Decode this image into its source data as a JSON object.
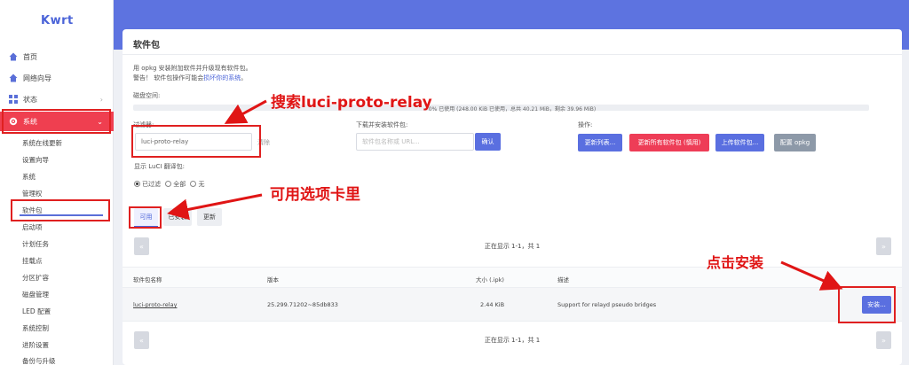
{
  "sidebar": {
    "logo": "Kwrt",
    "nav": [
      {
        "label": "首页",
        "icon": "home-icon"
      },
      {
        "label": "网络向导",
        "icon": "wizard-icon"
      },
      {
        "label": "状态",
        "icon": "status-grid-icon",
        "chevron": "›"
      },
      {
        "label": "系统",
        "icon": "gear-icon",
        "chevron": "⌄",
        "active": true
      }
    ],
    "sub_items": [
      "系统在线更新",
      "设置向导",
      "系统",
      "管理权",
      "软件包",
      "启动项",
      "计划任务",
      "挂载点",
      "分区扩容",
      "磁盘管理",
      "LED 配置",
      "系统控制",
      "进阶设置",
      "备份与升级"
    ],
    "active_sub": "软件包"
  },
  "page": {
    "title": "软件包",
    "intro_line1": "用 opkg 安装附加软件并升级现有软件包。",
    "warning_prefix": "警告！ 软件包操作可能会",
    "warning_link": "损坏你的系统",
    "warning_suffix": "。",
    "disk_label": "磁盘空间:",
    "disk_usage_text": "0% 已使用 (248.00 KiB 已使用，总共 40.21 MiB，剩余 39.96 MiB)",
    "disk_used_fraction": 0.0,
    "filter_label": "过滤器:",
    "filter_value": "luci-proto-relay",
    "clear_button": "清除",
    "download_label": "下载并安装软件包:",
    "download_placeholder": "软件包名称或 URL...",
    "confirm_button": "确认",
    "actions_label": "操作:",
    "action_buttons": [
      "更新列表...",
      "更新所有软件包 (慎用)",
      "上传软件包...",
      "配置 opkg"
    ],
    "translation_label": "显示 LuCI 翻译包:",
    "radio_options": [
      "已过滤",
      "全部",
      "无"
    ],
    "radio_selected": "已过滤",
    "tabs": [
      "可用",
      "已安装",
      "更新"
    ],
    "active_tab": "可用",
    "pager_text": "正在显示 1-1，共 1",
    "pager_prev": "«",
    "pager_next": "»",
    "table": {
      "headers": [
        "软件包名称",
        "版本",
        "大小 (.ipk)",
        "描述"
      ],
      "rows": [
        {
          "name": "luci-proto-relay",
          "version": "25.299.71202~85db833",
          "size": "2.44 KiB",
          "description": "Support for relayd pseudo bridges",
          "action": "安装..."
        }
      ]
    }
  },
  "annotations": {
    "search": "搜索luci-proto-relay",
    "tab": "可用选项卡里",
    "install": "点击安装"
  },
  "colors": {
    "accent": "#5d73e0",
    "active_nav": "#ef3f50",
    "annotation_red": "#e01515"
  }
}
